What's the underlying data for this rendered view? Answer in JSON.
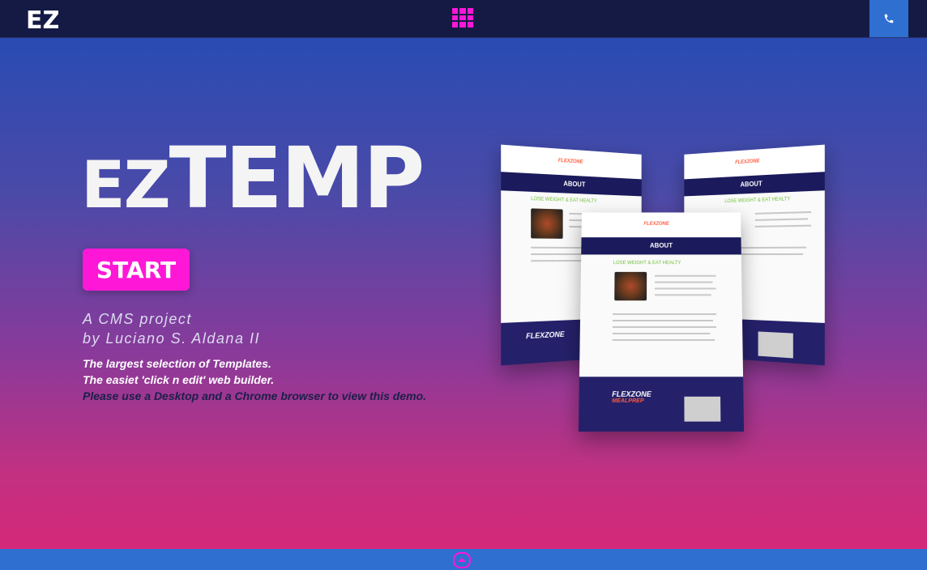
{
  "header": {
    "logo_text": "EZ",
    "apps_icon": "grid-icon",
    "phone_icon": "phone-icon"
  },
  "hero": {
    "title_prefix": "EZ",
    "title_main": "TEMP",
    "start_label": "START",
    "tagline_line1": "A CMS project",
    "tagline_line2": "by Luciano S. Aldana II",
    "desc_line1": "The largest selection of Templates.",
    "desc_line2": "The easiet 'click n edit' web builder.",
    "desc_line3": "Please use a Desktop and a Chrome browser to view this demo."
  },
  "mockup": {
    "brand": "FLEXZONE",
    "brand_sub": "MEALPREP",
    "section_title": "ABOUT",
    "headline": "LOSE WEIGHT & EAT HEALTY"
  },
  "footer": {
    "scroll_icon": "chevron-up-icon"
  },
  "colors": {
    "accent": "#ff17d8",
    "nav_bg": "#141a44",
    "button_blue": "#2f6fd0"
  }
}
